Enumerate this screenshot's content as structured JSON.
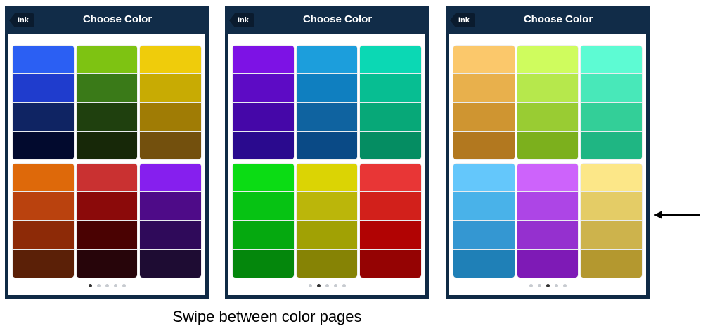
{
  "back_label": "Ink",
  "title": "Choose Color",
  "caption": "Swipe between color pages",
  "screens": [
    {
      "active_page": 0,
      "page_count": 5,
      "groups": [
        [
          "#2b5ff3",
          "#1f3ccd",
          "#0f2463",
          "#020a2e"
        ],
        [
          "#7ec312",
          "#3a7a18",
          "#1f400e",
          "#172808"
        ],
        [
          "#efcc0b",
          "#c8ab03",
          "#a07c05",
          "#73500d"
        ],
        [
          "#de690a",
          "#ba420e",
          "#8d2a07",
          "#5b2007"
        ],
        [
          "#c93131",
          "#8b0a0a",
          "#4a0202",
          "#27050a"
        ],
        [
          "#861fee",
          "#4e0b88",
          "#2f0a5a",
          "#1e0c33"
        ]
      ]
    },
    {
      "active_page": 1,
      "page_count": 5,
      "groups": [
        [
          "#7d12e5",
          "#5d0bc5",
          "#4507a8",
          "#2a0a8e"
        ],
        [
          "#1c9edc",
          "#0f7fc0",
          "#0f63a0",
          "#0a4a86"
        ],
        [
          "#0bd8b4",
          "#07be92",
          "#07a878",
          "#058d62"
        ],
        [
          "#0bdc14",
          "#06c313",
          "#05a90f",
          "#04870c"
        ],
        [
          "#dbd404",
          "#bbb60a",
          "#a1a104",
          "#868305"
        ],
        [
          "#e83636",
          "#d2201b",
          "#b10303",
          "#950303"
        ]
      ]
    },
    {
      "active_page": 2,
      "page_count": 5,
      "groups": [
        [
          "#fbc86b",
          "#e8b04c",
          "#cf9531",
          "#b2781f"
        ],
        [
          "#cffc5e",
          "#b6e84c",
          "#99cc33",
          "#7cb01d"
        ],
        [
          "#5dfbd3",
          "#48e8b9",
          "#33cf98",
          "#1fb683"
        ],
        [
          "#64c7fb",
          "#49b2e9",
          "#3497d2",
          "#1f80b7"
        ],
        [
          "#cd63fb",
          "#ad45e6",
          "#9530cf",
          "#7e1ab6"
        ],
        [
          "#fce788",
          "#e4cc66",
          "#cdb34c",
          "#b4982f"
        ]
      ]
    }
  ]
}
